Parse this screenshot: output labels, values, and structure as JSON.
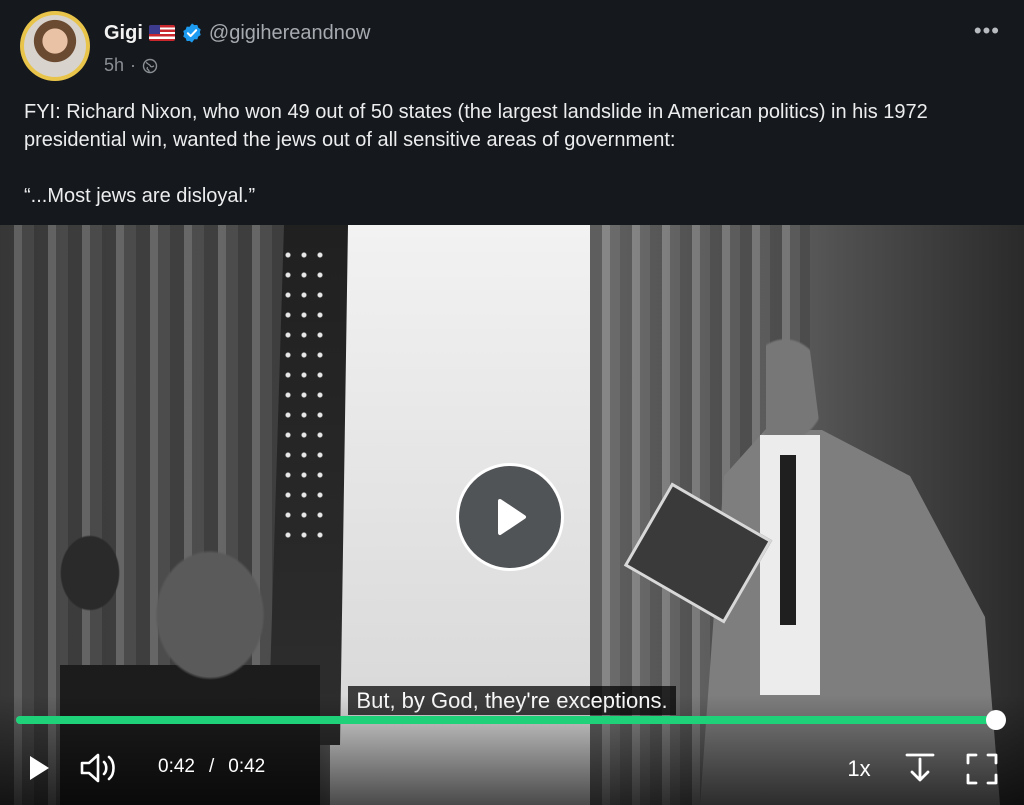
{
  "author": {
    "name": "Gigi",
    "flag_emoji": "🇺🇸",
    "handle": "@gigihereandnow",
    "verified": true,
    "time_ago": "5h",
    "separator": "·",
    "visibility_icon": "globe-icon"
  },
  "more_label": "•••",
  "post": {
    "line1": "FYI: Richard Nixon, who won 49 out of 50 states (the largest landslide in American politics) in his 1972 presidential win, wanted the jews out of all sensitive areas of government:",
    "line2": "“...Most jews are disloyal.”"
  },
  "video": {
    "subtitle": "But, by God, they're exceptions.",
    "progress": 1.0,
    "current_time": "0:42",
    "time_separator": "/",
    "duration": "0:42",
    "speed": "1x",
    "accent_color": "#1fd27a",
    "icons": {
      "play": "play-icon",
      "volume": "volume-icon",
      "download": "download-icon",
      "fullscreen": "fullscreen-icon"
    }
  }
}
